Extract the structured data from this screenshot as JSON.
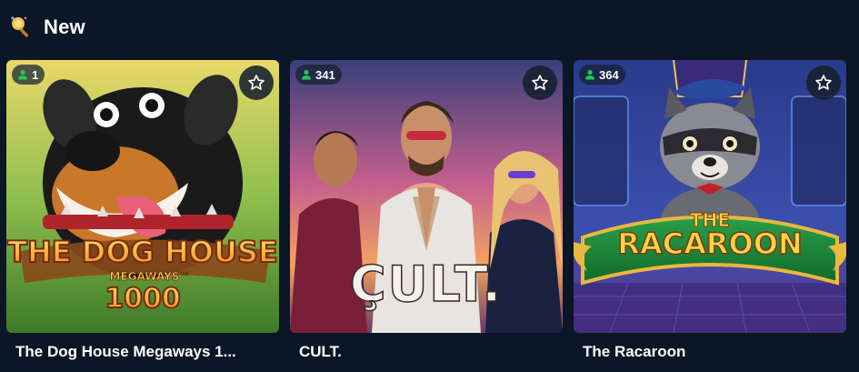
{
  "section": {
    "title": "New",
    "icon": "sparkle-wand-icon"
  },
  "games": [
    {
      "title": "The Dog House Megaways 1...",
      "players": "1",
      "logo_lines": [
        "THE DOG HOUSE",
        "MEGAWAYS™",
        "1000"
      ]
    },
    {
      "title": "CULT.",
      "players": "341",
      "logo_lines": [
        "ÇULT."
      ]
    },
    {
      "title": "The Racaroon",
      "players": "364",
      "logo_lines": [
        "THE",
        "RACAROON"
      ]
    }
  ],
  "colors": {
    "background": "#0b1626",
    "player_icon": "#22c55e",
    "badge_bg": "#142030"
  }
}
